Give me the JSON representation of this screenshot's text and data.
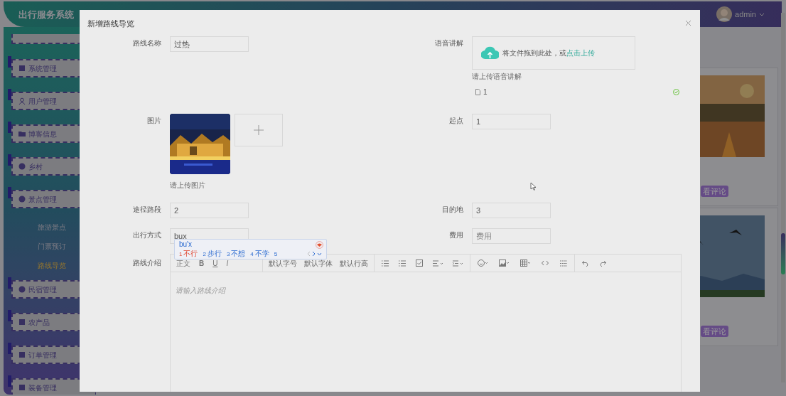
{
  "app": {
    "title": "出行服务系统",
    "user": "admin"
  },
  "sidebar": {
    "items": [
      {
        "label": "系统管理"
      },
      {
        "label": "用户管理"
      },
      {
        "label": "博客信息"
      },
      {
        "label": "乡村"
      },
      {
        "label": "景点管理",
        "children": [
          {
            "label": "旅游景点",
            "selected": false
          },
          {
            "label": "门票预订",
            "selected": false
          },
          {
            "label": "路线导览",
            "selected": true
          }
        ]
      },
      {
        "label": "民宿管理"
      },
      {
        "label": "农产品"
      },
      {
        "label": "订单管理"
      },
      {
        "label": "装备管理"
      }
    ]
  },
  "background_cards": [
    {
      "kind": "picture",
      "button": "看评论"
    },
    {
      "kind": "picture",
      "button": "看评论"
    }
  ],
  "dialog": {
    "title": "新增路线导览",
    "route_name": {
      "label": "路线名称",
      "value": "过热"
    },
    "voice_guide": {
      "label": "语音讲解",
      "drop_text": "将文件拖到此处，或",
      "upload_link": "点击上传",
      "hint": "请上传语音讲解",
      "files": [
        {
          "name": "1",
          "uploaded": true
        }
      ]
    },
    "picture": {
      "label": "图片",
      "hint": "请上传图片"
    },
    "start": {
      "label": "起点",
      "value": "1"
    },
    "segments": {
      "label": "途径路段",
      "value": "2"
    },
    "destination": {
      "label": "目的地",
      "value": "3"
    },
    "travel_mode": {
      "label": "出行方式",
      "value": "bux"
    },
    "cost": {
      "label": "费用",
      "placeholder": "费用"
    },
    "intro": {
      "label": "路线介绍",
      "placeholder": "请输入路线介绍",
      "toolbar_texts": [
        "正文",
        "B",
        "U",
        "I"
      ],
      "toolbar_defaults": [
        "默认字号",
        "默认字体",
        "默认行高"
      ]
    }
  },
  "ime": {
    "composition": "bu'x",
    "candidates": [
      {
        "index": "1",
        "text": "不行",
        "selected": true
      },
      {
        "index": "2",
        "text": "步行",
        "selected": false
      },
      {
        "index": "3",
        "text": "不想",
        "selected": false
      },
      {
        "index": "4",
        "text": "不学",
        "selected": false
      },
      {
        "index": "5",
        "selected": false
      }
    ]
  }
}
